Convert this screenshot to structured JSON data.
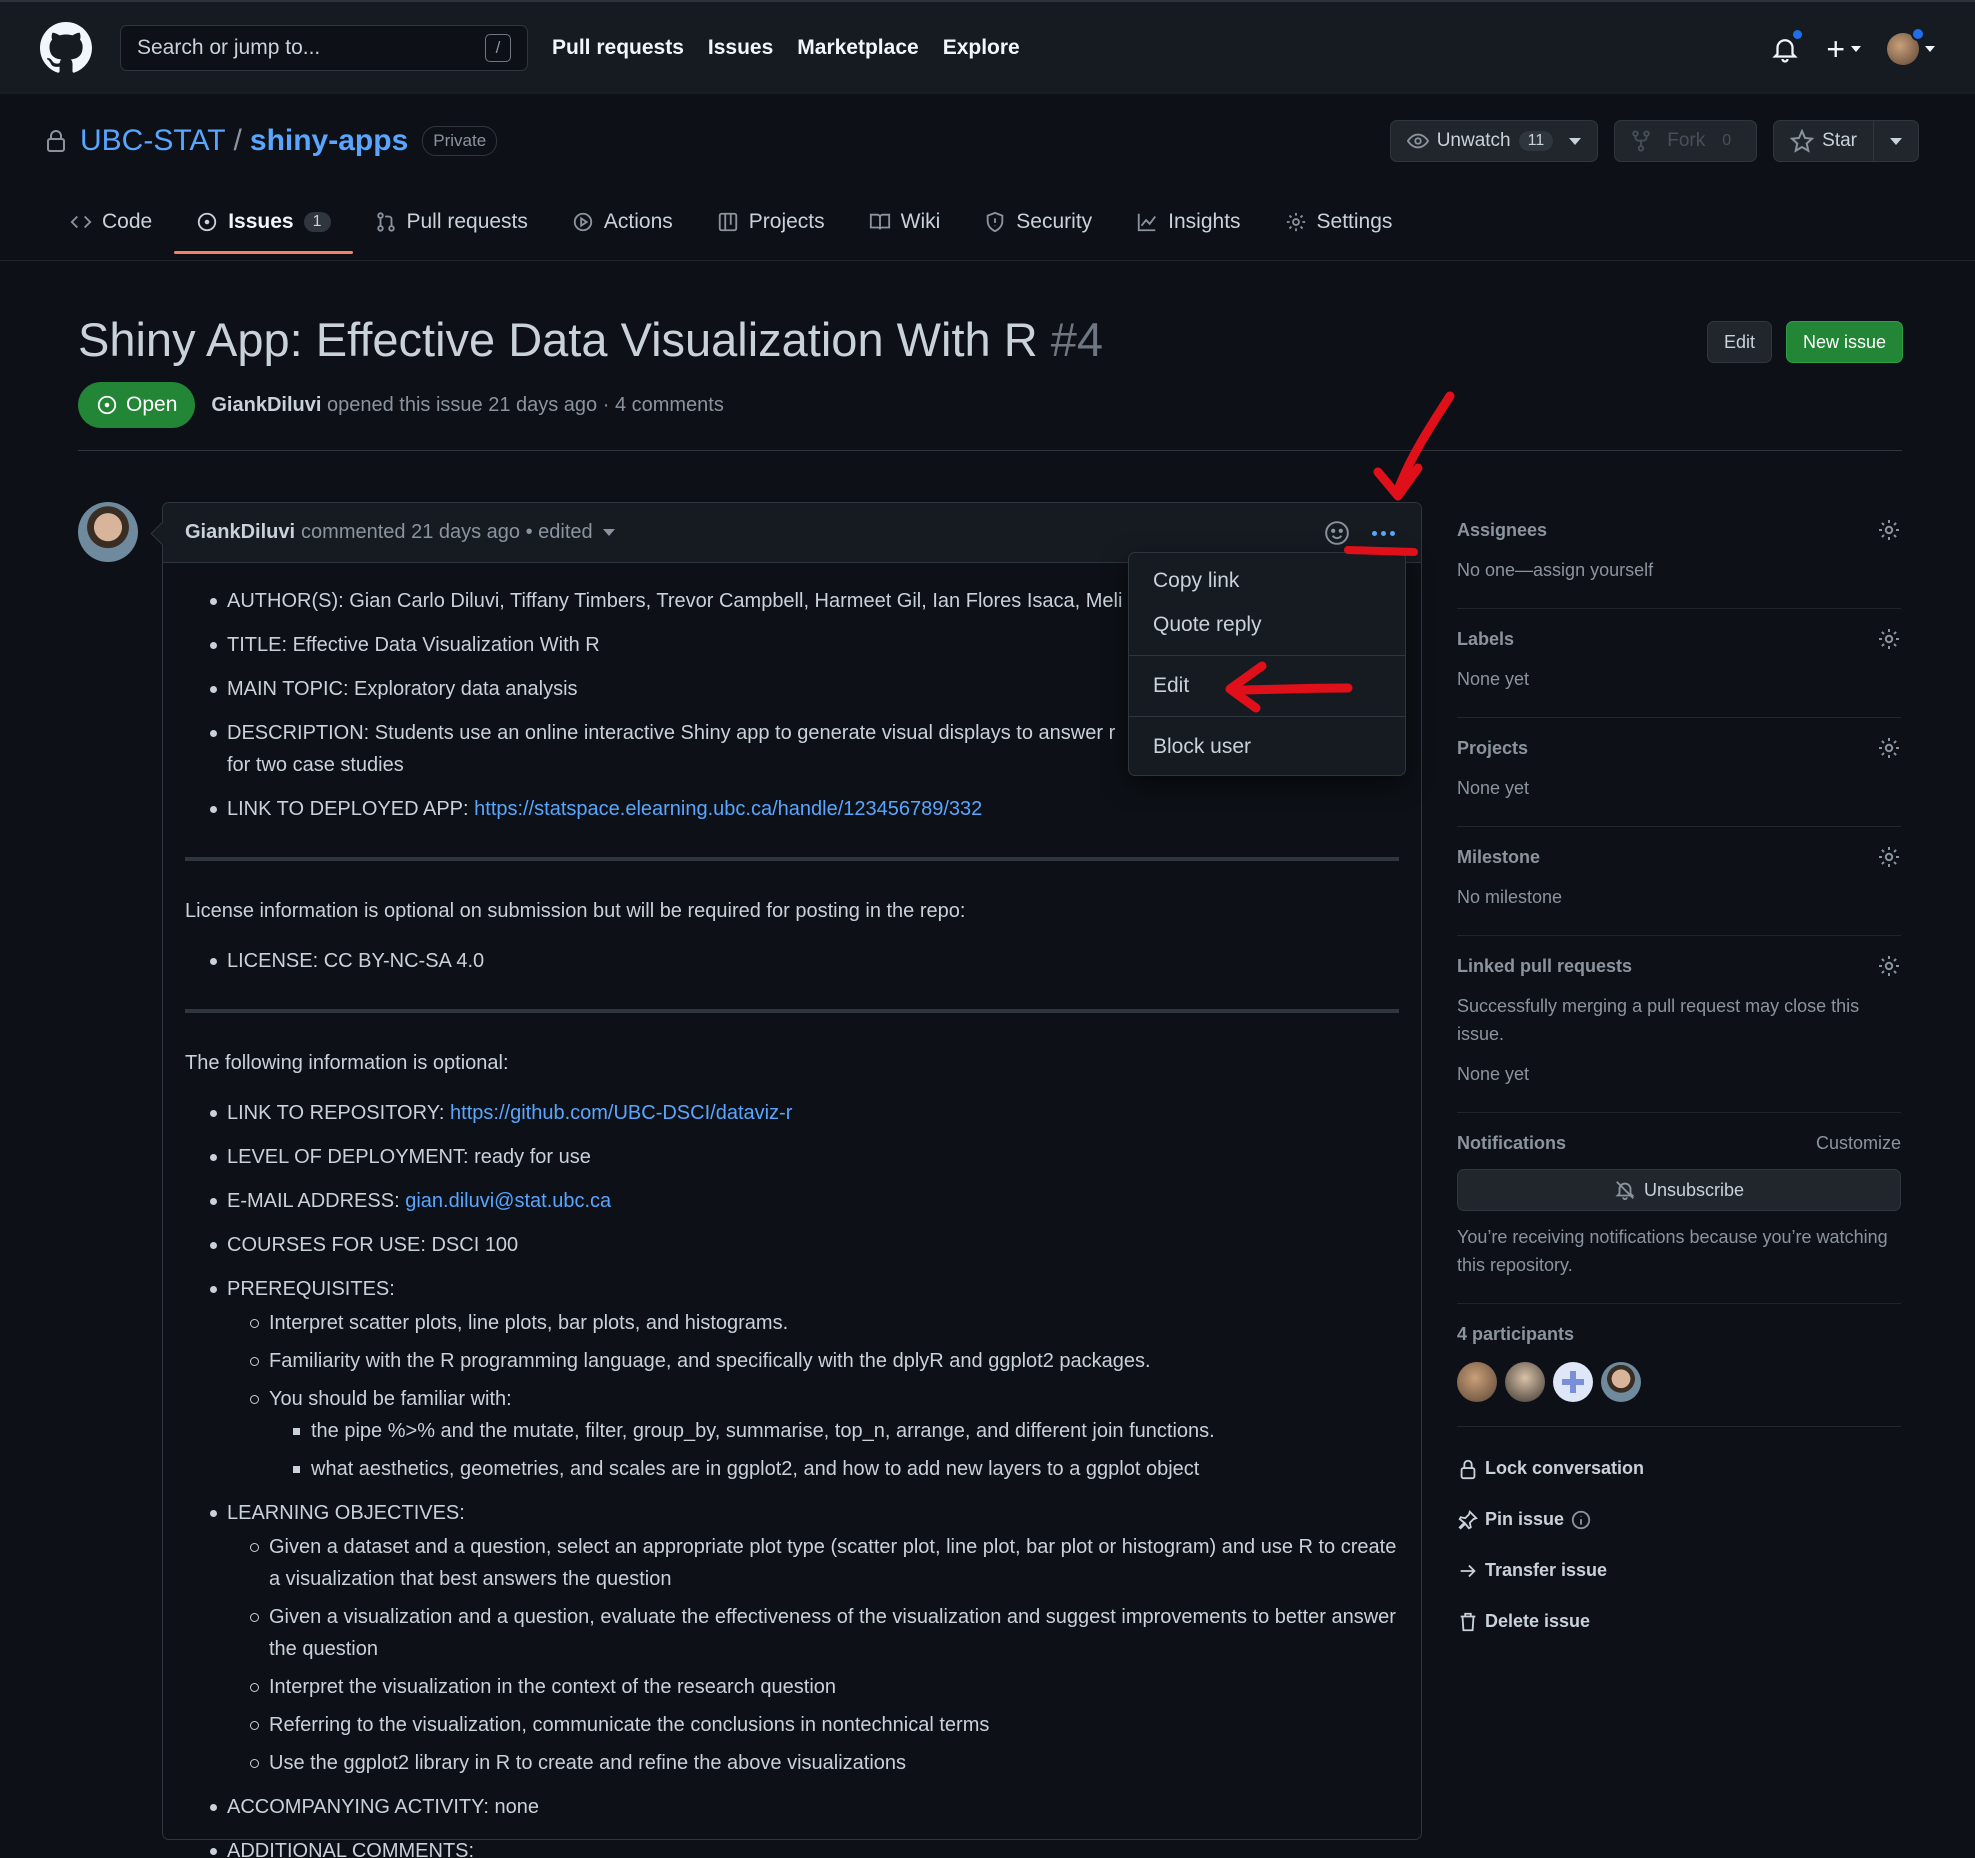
{
  "header": {
    "search_placeholder": "Search or jump to...",
    "search_key": "/",
    "nav": [
      "Pull requests",
      "Issues",
      "Marketplace",
      "Explore"
    ],
    "plus": "+"
  },
  "repo": {
    "owner": "UBC-STAT",
    "separator": "/",
    "name": "shiny-apps",
    "visibility": "Private",
    "unwatch_label": "Unwatch",
    "watch_count": "11",
    "fork_label": "Fork",
    "fork_count": "0",
    "star_label": "Star"
  },
  "tabs": {
    "code": "Code",
    "issues": "Issues",
    "issues_count": "1",
    "pull_requests": "Pull requests",
    "actions": "Actions",
    "projects": "Projects",
    "wiki": "Wiki",
    "security": "Security",
    "insights": "Insights",
    "settings": "Settings"
  },
  "issue": {
    "title": "Shiny App: Effective Data Visualization With R",
    "number": "#4",
    "edit_label": "Edit",
    "new_issue_label": "New issue",
    "state": "Open",
    "author": "GiankDiluvi",
    "meta": "opened this issue 21 days ago · 4 comments"
  },
  "comment": {
    "author": "GiankDiluvi",
    "meta": "commented 21 days ago • edited",
    "section1": [
      "AUTHOR(S): Gian Carlo Diluvi, Tiffany Timbers, Trevor Campbell, Harmeet Gil, Ian Flores Isaca, Meli",
      "TITLE: Effective Data Visualization With R",
      "MAIN TOPIC: Exploratory data analysis",
      "DESCRIPTION: Students use an online interactive Shiny app to generate visual displays to answer r",
      "for two case studies"
    ],
    "deployed_label": "LINK TO DEPLOYED APP: ",
    "deployed_url": "https://statspace.elearning.ubc.ca/handle/123456789/332",
    "license_intro": "License information is optional on submission but will be required for posting in the repo:",
    "license": "LICENSE: CC BY-NC-SA 4.0",
    "optional_intro": "The following information is optional:",
    "repo_label": "LINK TO REPOSITORY: ",
    "repo_url": "https://github.com/UBC-DSCI/dataviz-r",
    "level": "LEVEL OF DEPLOYMENT: ready for use",
    "email_label": "E-MAIL ADDRESS: ",
    "email": "gian.diluvi@stat.ubc.ca",
    "courses": "COURSES FOR USE: DSCI 100",
    "prereq_label": "PREREQUISITES:",
    "prereqs": [
      "Interpret scatter plots, line plots, bar plots, and histograms.",
      "Familiarity with the R programming language, and specifically with the dplyR and ggplot2 packages.",
      "You should be familiar with:"
    ],
    "familiar": [
      "the pipe %>% and the mutate, filter, group_by, summarise, top_n, arrange, and different join functions.",
      "what aesthetics, geometries, and scales are in ggplot2, and how to add new layers to a ggplot object"
    ],
    "objectives_label": "LEARNING OBJECTIVES:",
    "objectives": [
      "Given a dataset and a question, select an appropriate plot type (scatter plot, line plot, bar plot or histogram) and use R to create a visualization that best answers the question",
      "Given a visualization and a question, evaluate the effectiveness of the visualization and suggest improvements to better answer the question",
      "Interpret the visualization in the context of the research question",
      "Referring to the visualization, communicate the conclusions in nontechnical terms",
      "Use the ggplot2 library in R to create and refine the above visualizations"
    ],
    "activity": "ACCOMPANYING ACTIVITY: none",
    "comments": "ADDITIONAL COMMENTS:"
  },
  "menu": {
    "copy_link": "Copy link",
    "quote_reply": "Quote reply",
    "edit": "Edit",
    "block_user": "Block user"
  },
  "sidebar": {
    "assignees_title": "Assignees",
    "assignees_value": "No one—assign yourself",
    "labels_title": "Labels",
    "labels_value": "None yet",
    "projects_title": "Projects",
    "projects_value": "None yet",
    "milestone_title": "Milestone",
    "milestone_value": "No milestone",
    "linked_title": "Linked pull requests",
    "linked_desc": "Successfully merging a pull request may close this issue.",
    "linked_value": "None yet",
    "notifications_title": "Notifications",
    "customize": "Customize",
    "unsubscribe": "Unsubscribe",
    "notifications_desc": "You’re receiving notifications because you’re watching this repository.",
    "participants_title": "4 participants",
    "lock": "Lock conversation",
    "pin": "Pin issue",
    "transfer": "Transfer issue",
    "delete": "Delete issue"
  },
  "colors": {
    "accent_blue": "#58a6ff",
    "open_green": "#238636",
    "tab_underline": "#f78166",
    "annotation_red": "#e0101a"
  },
  "icons": [
    "github-logo-icon",
    "bell-icon",
    "plus-icon",
    "lock-icon",
    "eye-icon",
    "fork-icon",
    "star-icon",
    "code-icon",
    "issue-open-icon",
    "pull-request-icon",
    "play-icon",
    "table-icon",
    "book-icon",
    "shield-icon",
    "graph-icon",
    "gear-icon",
    "smiley-icon",
    "kebab-icon",
    "bell-slash-icon",
    "pin-icon",
    "info-icon",
    "arrow-right-icon",
    "trash-icon"
  ]
}
